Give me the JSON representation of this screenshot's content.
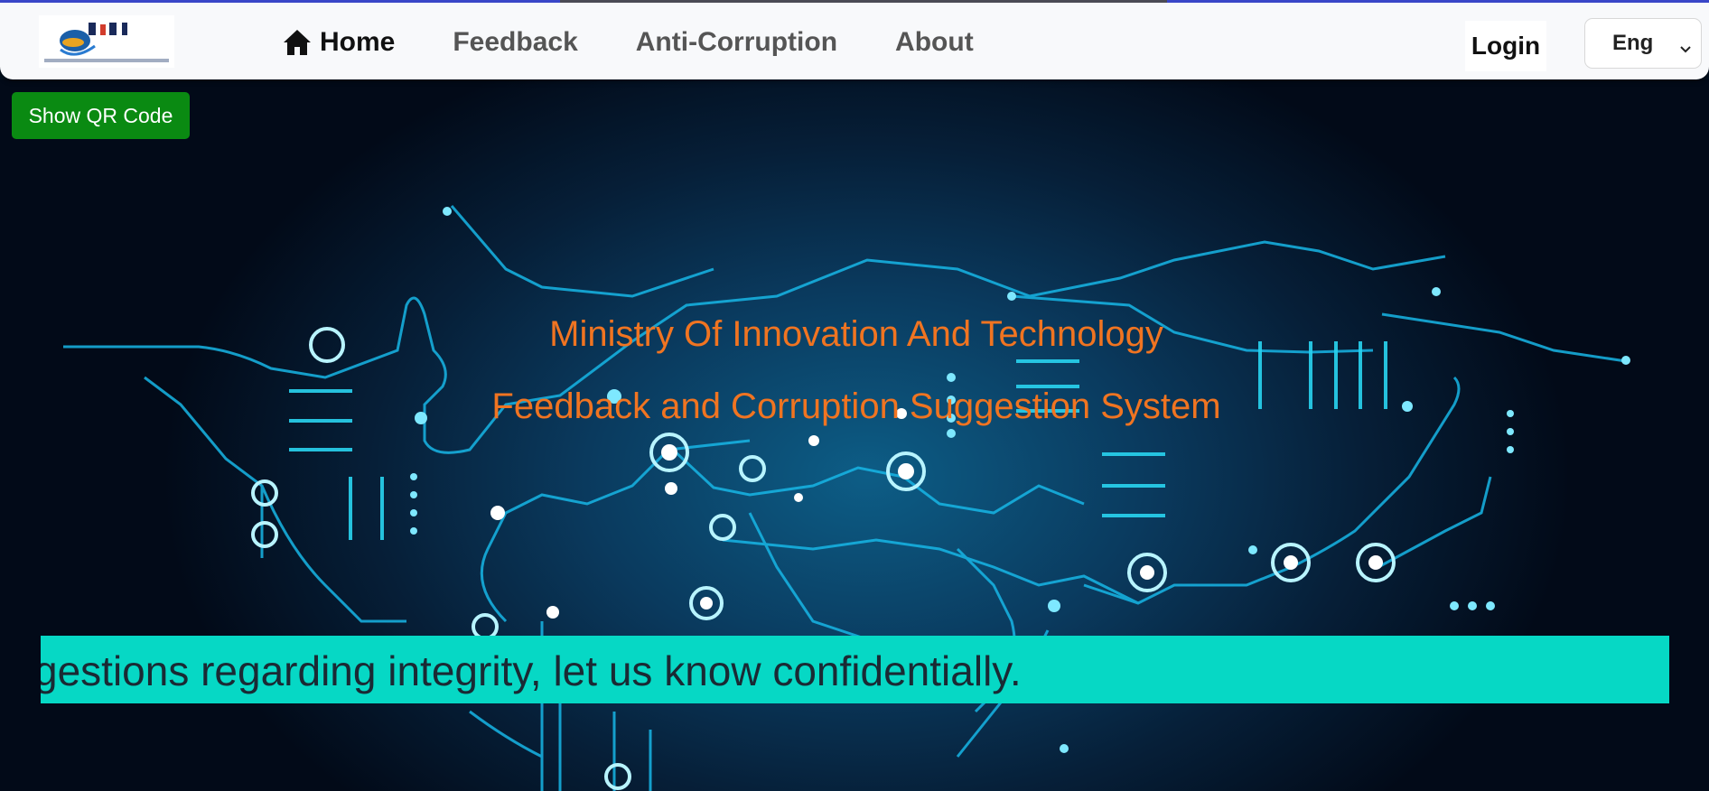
{
  "header": {
    "logo_icon": "mint-ministry-logo",
    "nav": [
      {
        "label": "Home",
        "icon": "home-icon",
        "active": true
      },
      {
        "label": "Feedback",
        "active": false
      },
      {
        "label": "Anti-Corruption",
        "active": false
      },
      {
        "label": "About",
        "active": false
      }
    ],
    "login_label": "Login",
    "language": {
      "selected": "Eng",
      "icon": "chevron-down-icon"
    }
  },
  "hero": {
    "qr_button_label": "Show QR Code",
    "title": "Ministry Of Innovation And Technology",
    "subtitle": "Feedback and Corruption Suggestion System",
    "marquee_text": "gestions regarding integrity, let us know confidentially."
  },
  "colors": {
    "title": "#f07421",
    "qr_button": "#0a8a12",
    "marquee_bg": "#06d8c5",
    "circuit": "#17b6e6"
  }
}
